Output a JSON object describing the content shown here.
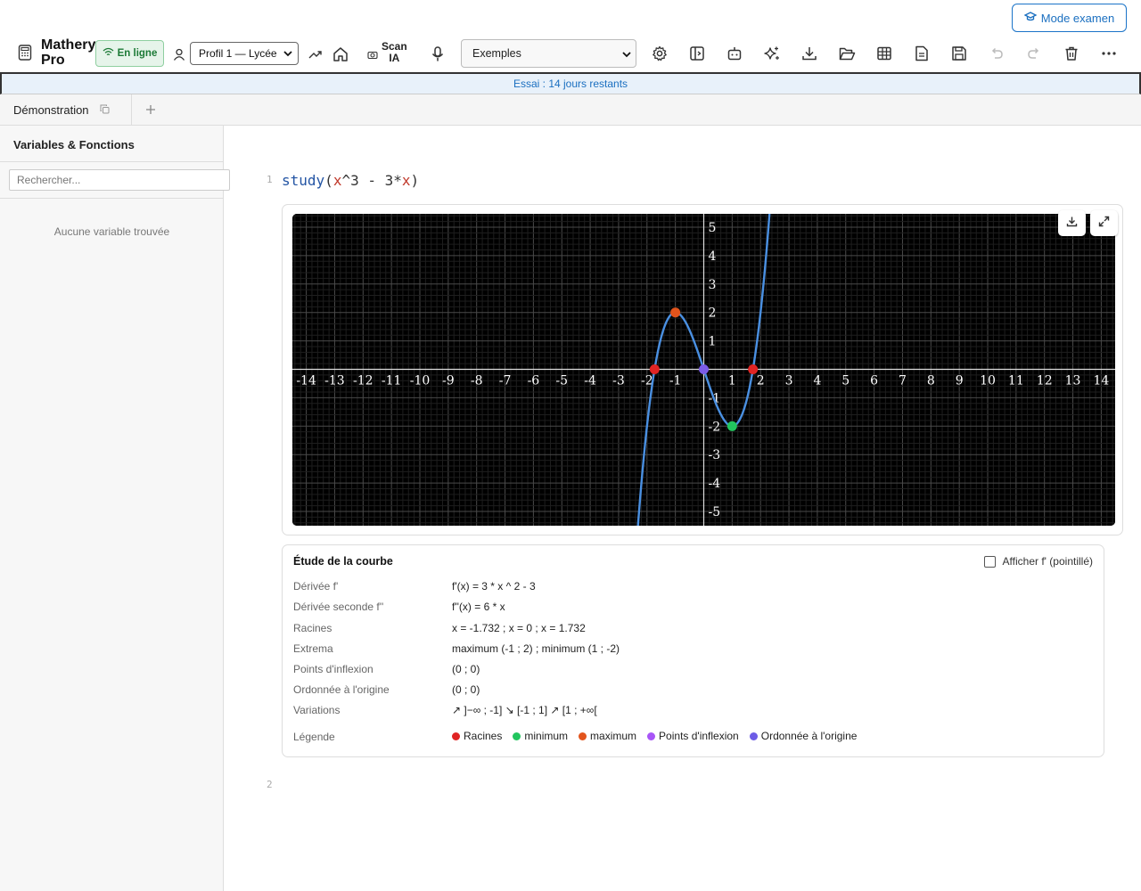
{
  "exam_mode": {
    "label": "Mode examen"
  },
  "toolbar": {
    "brand": [
      "Mathery",
      "Pro"
    ],
    "online_label": "En ligne",
    "profile_selected": "Profil 1 — Lycée",
    "scan_label": [
      "Scan",
      "IA"
    ],
    "examples_selected": "Exemples",
    "icons": [
      "calculator-icon",
      "wifi-icon",
      "user-icon",
      "trend-icon",
      "home-icon",
      "camera-icon",
      "microphone-icon",
      "settings-icon",
      "sidebar-panel-icon",
      "robot-icon",
      "sparkles-icon",
      "download-icon",
      "folder-open-icon",
      "table-icon",
      "document-icon",
      "save-icon",
      "undo-icon",
      "redo-icon",
      "trash-icon",
      "more-icon"
    ]
  },
  "trial_banner": "Essai : 14 jours restants",
  "tabs": [
    {
      "label": "Démonstration"
    }
  ],
  "sidebar": {
    "title": "Variables & Fonctions",
    "search_placeholder": "Rechercher...",
    "empty_message": "Aucune variable trouvée"
  },
  "editor": {
    "lines": [
      {
        "number": "1",
        "code": {
          "fn": "study",
          "open": "(",
          "v1": "x",
          "mid": "^3 - 3*",
          "v2": "x",
          "close": ")"
        }
      },
      {
        "number": "2"
      }
    ]
  },
  "chart_data": {
    "type": "line",
    "function": "x^3 - 3x",
    "xlim": [
      -14.5,
      14.5
    ],
    "ylim": [
      -5.5,
      5.5
    ],
    "x_ticks": [
      -14,
      -13,
      -12,
      -11,
      -10,
      -9,
      -8,
      -7,
      -6,
      -5,
      -4,
      -3,
      -2,
      -1,
      1,
      2,
      3,
      4,
      5,
      6,
      7,
      8,
      9,
      10,
      11,
      12,
      13,
      14
    ],
    "y_ticks": [
      -5,
      -4,
      -3,
      -2,
      -1,
      1,
      2,
      3,
      4,
      5
    ],
    "grid": true,
    "background": "#000000",
    "curve_color": "#4a90e2",
    "points": [
      {
        "x": -1.732,
        "y": 0,
        "kind": "Racines",
        "color": "#e02424"
      },
      {
        "x": 1.732,
        "y": 0,
        "kind": "Racines",
        "color": "#e02424"
      },
      {
        "x": -1,
        "y": 2,
        "kind": "maximum",
        "color": "#e2541c"
      },
      {
        "x": 1,
        "y": -2,
        "kind": "minimum",
        "color": "#22c55e"
      },
      {
        "x": 0,
        "y": 0,
        "kind": "Ordonnée à l'origine",
        "color": "#7c5ce6"
      }
    ]
  },
  "study": {
    "title": "Étude de la courbe",
    "toggle_label": "Afficher f' (pointillé)",
    "rows": [
      {
        "label": "Dérivée f'",
        "value": "f'(x) = 3 * x ^ 2 - 3"
      },
      {
        "label": "Dérivée seconde f''",
        "value": "f''(x) = 6 * x"
      },
      {
        "label": "Racines",
        "value": "x = -1.732 ; x = 0 ; x = 1.732"
      },
      {
        "label": "Extrema",
        "value": "maximum (-1 ; 2) ; minimum (1 ; -2)"
      },
      {
        "label": "Points d'inflexion",
        "value": "(0 ; 0)"
      },
      {
        "label": "Ordonnée à l'origine",
        "value": "(0 ; 0)"
      },
      {
        "label": "Variations",
        "value": "↗ ]−∞ ; -1] ↘ [-1 ; 1] ↗ [1 ; +∞["
      }
    ],
    "legend_label": "Légende",
    "legend": [
      {
        "label": "Racines",
        "color": "#e02424"
      },
      {
        "label": "minimum",
        "color": "#22c55e"
      },
      {
        "label": "maximum",
        "color": "#e2541c"
      },
      {
        "label": "Points d'inflexion",
        "color": "#a855f7"
      },
      {
        "label": "Ordonnée à l'origine",
        "color": "#6d5ce6"
      }
    ]
  }
}
